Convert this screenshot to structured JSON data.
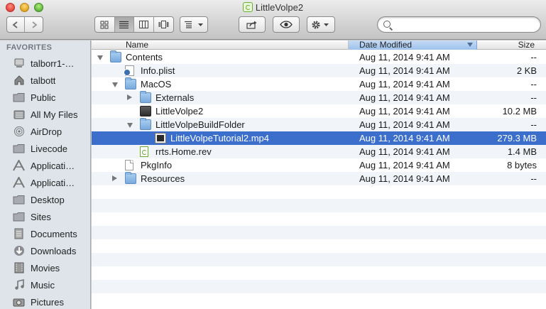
{
  "window": {
    "title": "LittleVolpe2"
  },
  "search": {
    "value": "",
    "placeholder": ""
  },
  "sidebar": {
    "section_label": "FAVORITES",
    "items": [
      {
        "label": "talborr1-…",
        "icon": "computer-icon"
      },
      {
        "label": "talbott",
        "icon": "home-icon"
      },
      {
        "label": "Public",
        "icon": "folder-icon"
      },
      {
        "label": "All My Files",
        "icon": "all-files-icon"
      },
      {
        "label": "AirDrop",
        "icon": "airdrop-icon"
      },
      {
        "label": "Livecode",
        "icon": "folder-icon"
      },
      {
        "label": "Applicati…",
        "icon": "applications-icon"
      },
      {
        "label": "Applicati…",
        "icon": "applications-icon"
      },
      {
        "label": "Desktop",
        "icon": "folder-icon"
      },
      {
        "label": "Sites",
        "icon": "folder-icon"
      },
      {
        "label": "Documents",
        "icon": "documents-icon"
      },
      {
        "label": "Downloads",
        "icon": "downloads-icon"
      },
      {
        "label": "Movies",
        "icon": "movies-icon"
      },
      {
        "label": "Music",
        "icon": "music-icon"
      },
      {
        "label": "Pictures",
        "icon": "pictures-icon"
      }
    ]
  },
  "columns": {
    "name": "Name",
    "date": "Date Modified",
    "size": "Size"
  },
  "files": [
    {
      "name": "Contents",
      "date": "Aug 11, 2014 9:41 AM",
      "size": "--",
      "icon": "folder",
      "disclosure": "open",
      "depth": 0
    },
    {
      "name": "Info.plist",
      "date": "Aug 11, 2014 9:41 AM",
      "size": "2 KB",
      "icon": "plist",
      "disclosure": "none",
      "depth": 1
    },
    {
      "name": "MacOS",
      "date": "Aug 11, 2014 9:41 AM",
      "size": "--",
      "icon": "folder",
      "disclosure": "open",
      "depth": 1
    },
    {
      "name": "Externals",
      "date": "Aug 11, 2014 9:41 AM",
      "size": "--",
      "icon": "folder",
      "disclosure": "closed",
      "depth": 2
    },
    {
      "name": "LittleVolpe2",
      "date": "Aug 11, 2014 9:41 AM",
      "size": "10.2 MB",
      "icon": "exec",
      "disclosure": "none",
      "depth": 2
    },
    {
      "name": "LittleVolpeBuildFolder",
      "date": "Aug 11, 2014 9:41 AM",
      "size": "--",
      "icon": "folder",
      "disclosure": "open",
      "depth": 2
    },
    {
      "name": "LittleVolpeTutorial2.mp4",
      "date": "Aug 11, 2014 9:41 AM",
      "size": "279.3 MB",
      "icon": "video",
      "disclosure": "none",
      "depth": 3,
      "selected": true
    },
    {
      "name": "rrts.Home.rev",
      "date": "Aug 11, 2014 9:41 AM",
      "size": "1.4 MB",
      "icon": "rev",
      "disclosure": "none",
      "depth": 2
    },
    {
      "name": "PkgInfo",
      "date": "Aug 11, 2014 9:41 AM",
      "size": "8 bytes",
      "icon": "doc",
      "disclosure": "none",
      "depth": 1
    },
    {
      "name": "Resources",
      "date": "Aug 11, 2014 9:41 AM",
      "size": "--",
      "icon": "folder",
      "disclosure": "closed",
      "depth": 1
    }
  ],
  "colors": {
    "selection": "#3b6fcb",
    "sidebar_bg": "#dee4ea",
    "header_sorted": "#9dc1ec"
  }
}
